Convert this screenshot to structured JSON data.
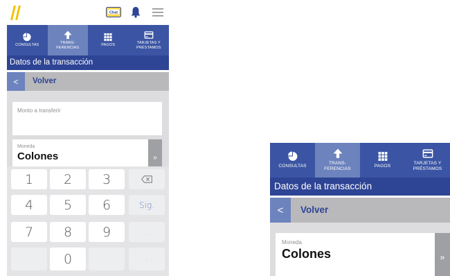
{
  "nav": [
    {
      "label": "CONSULTAS",
      "icon": "pie-chart-icon"
    },
    {
      "label": "TRANS-\nFERENCIAS",
      "icon": "arrow-up-icon"
    },
    {
      "label": "PAGOS",
      "icon": "grid-icon"
    },
    {
      "label": "TARJETAS Y\nPRÉSTAMOS",
      "icon": "card-icon"
    }
  ],
  "topbar": {
    "chat_badge": "Chat"
  },
  "section_title": "Datos de la transacción",
  "back_label": "Volver",
  "amount_label": "Monto a transferir",
  "currency": {
    "label": "Moneda",
    "value": "Colones",
    "arrow": "»"
  },
  "keypad": {
    "k1": "1",
    "k2": "2",
    "k3": "3",
    "k4": "4",
    "k5": "5",
    "k6": "6",
    "sig": "Sig.",
    "k7": "7",
    "k8": "8",
    "k9": "9",
    "dot": ".",
    "k0": "0",
    "dot2": ","
  },
  "colors": {
    "nav_bg": "#3b55a4",
    "nav_active": "#6d83bd",
    "section_bg": "#2e4494",
    "back_bg": "#b9b9bb"
  }
}
